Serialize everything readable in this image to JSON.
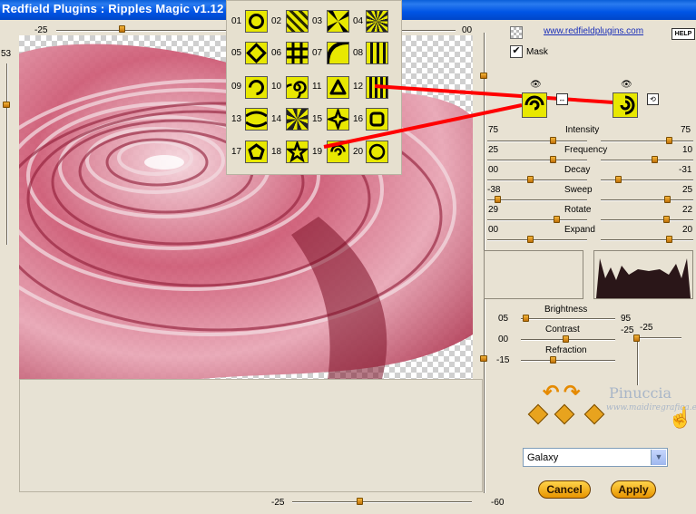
{
  "window": {
    "title": "Redfield Plugins : Ripples Magic v1.12"
  },
  "top_slider": {
    "left_value": "-25",
    "right_value": "00"
  },
  "left_slider": {
    "value": "53"
  },
  "bottom_slider": {
    "left_value": "-25",
    "right_value": "-60"
  },
  "palette": {
    "items": [
      {
        "number": "01",
        "icon": "ring-pattern"
      },
      {
        "number": "02",
        "icon": "checker-wave-pattern"
      },
      {
        "number": "03",
        "icon": "radial-burst-pattern"
      },
      {
        "number": "04",
        "icon": "starburst-pattern"
      },
      {
        "number": "05",
        "icon": "diamond-pattern"
      },
      {
        "number": "06",
        "icon": "grid-cross-pattern"
      },
      {
        "number": "07",
        "icon": "corner-sweep-pattern"
      },
      {
        "number": "08",
        "icon": "vertical-bars-pattern"
      },
      {
        "number": "09",
        "icon": "swirl-pattern"
      },
      {
        "number": "10",
        "icon": "spiral-pattern"
      },
      {
        "number": "11",
        "icon": "rounded-triangle-pattern"
      },
      {
        "number": "12",
        "icon": "stripes-pattern"
      },
      {
        "number": "13",
        "icon": "horizontal-arc-pattern"
      },
      {
        "number": "14",
        "icon": "pinwheel-pattern"
      },
      {
        "number": "15",
        "icon": "four-point-star-pattern"
      },
      {
        "number": "16",
        "icon": "square-ring-pattern"
      },
      {
        "number": "17",
        "icon": "pentagon-pattern"
      },
      {
        "number": "18",
        "icon": "star-pattern"
      },
      {
        "number": "19",
        "icon": "galaxy-swirl-pattern"
      },
      {
        "number": "20",
        "icon": "double-spiral-pattern"
      }
    ]
  },
  "header": {
    "link_text": "www.redfieldplugins.com",
    "help_label": "HELP",
    "mask_label": "Mask"
  },
  "params": {
    "intensity": {
      "label": "Intensity",
      "left": "75",
      "right": "75"
    },
    "frequency": {
      "label": "Frequency",
      "left": "25",
      "right": "10"
    },
    "decay": {
      "label": "Decay",
      "left": "00",
      "right": "-31"
    },
    "sweep": {
      "label": "Sweep",
      "left": "-38",
      "right": "25"
    },
    "rotate": {
      "label": "Rotate",
      "left": "29",
      "right": "22"
    },
    "expand": {
      "label": "Expand",
      "left": "00",
      "right": "20"
    }
  },
  "lighting": {
    "brightness": {
      "label": "Brightness",
      "value": "05",
      "right": "95"
    },
    "contrast": {
      "label": "Contrast",
      "value": "00"
    },
    "refraction": {
      "label": "Refraction",
      "value": "-15"
    },
    "light_h": "-25",
    "light_v": "-25"
  },
  "branding": {
    "name": "Pinuccia",
    "url": "www.maidiregrafica.eu"
  },
  "preset_select": {
    "value": "Galaxy"
  },
  "buttons": {
    "cancel": "Cancel",
    "apply": "Apply"
  },
  "colors": {
    "title_bar": "#0055e5",
    "accent": "#e79400",
    "pattern_yellow": "#e8e800",
    "arrow_red": "#ff0000",
    "ripple_pink": "#b8324b"
  }
}
